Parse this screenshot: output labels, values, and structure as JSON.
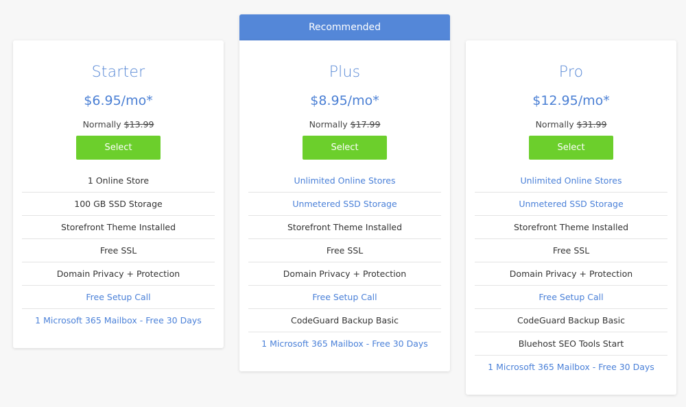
{
  "ribbon": {
    "label": "Recommended"
  },
  "plans": [
    {
      "name": "Starter",
      "price": "$6.95/mo*",
      "normally_label": "Normally",
      "normal_price": "$13.99",
      "button_label": "Select",
      "features": [
        {
          "text": "1 Online Store",
          "highlight": false
        },
        {
          "text": "100 GB SSD Storage",
          "highlight": false
        },
        {
          "text": "Storefront Theme Installed",
          "highlight": false
        },
        {
          "text": "Free SSL",
          "highlight": false
        },
        {
          "text": "Domain Privacy + Protection",
          "highlight": false
        },
        {
          "text": "Free Setup Call",
          "highlight": true
        },
        {
          "text": "1 Microsoft 365 Mailbox - Free 30 Days",
          "highlight": true
        }
      ]
    },
    {
      "name": "Plus",
      "price": "$8.95/mo*",
      "normally_label": "Normally",
      "normal_price": "$17.99",
      "button_label": "Select",
      "features": [
        {
          "text": "Unlimited Online Stores",
          "highlight": true
        },
        {
          "text": "Unmetered SSD Storage",
          "highlight": true
        },
        {
          "text": "Storefront Theme Installed",
          "highlight": false
        },
        {
          "text": "Free SSL",
          "highlight": false
        },
        {
          "text": "Domain Privacy + Protection",
          "highlight": false
        },
        {
          "text": "Free Setup Call",
          "highlight": true
        },
        {
          "text": "CodeGuard Backup Basic",
          "highlight": false
        },
        {
          "text": "1 Microsoft 365 Mailbox - Free 30 Days",
          "highlight": true
        }
      ]
    },
    {
      "name": "Pro",
      "price": "$12.95/mo*",
      "normally_label": "Normally",
      "normal_price": "$31.99",
      "button_label": "Select",
      "features": [
        {
          "text": "Unlimited Online Stores",
          "highlight": true
        },
        {
          "text": "Unmetered SSD Storage",
          "highlight": true
        },
        {
          "text": "Storefront Theme Installed",
          "highlight": false
        },
        {
          "text": "Free SSL",
          "highlight": false
        },
        {
          "text": "Domain Privacy + Protection",
          "highlight": false
        },
        {
          "text": "Free Setup Call",
          "highlight": true
        },
        {
          "text": "CodeGuard Backup Basic",
          "highlight": false
        },
        {
          "text": "Bluehost SEO Tools Start",
          "highlight": false
        },
        {
          "text": "1 Microsoft 365 Mailbox - Free 30 Days",
          "highlight": true
        }
      ]
    }
  ],
  "colors": {
    "background": "#f7f7f7",
    "accent_blue": "#5487d8",
    "plan_title_blue": "#5a8ad6",
    "link_blue": "#4a80d8",
    "select_green": "#6ccf2c",
    "text_dark": "#333333"
  }
}
